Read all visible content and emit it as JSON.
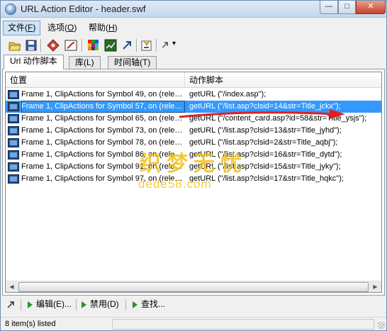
{
  "window": {
    "title": "URL Action Editor - header.swf",
    "controls": {
      "minimize": "—",
      "maximize": "□",
      "close": "✕"
    }
  },
  "menu": {
    "file": {
      "label": "文件(",
      "key": "F",
      "end": ")"
    },
    "options": {
      "label": "选项(",
      "key": "O",
      "end": ")"
    },
    "help": {
      "label": "帮助(",
      "key": "H",
      "end": ")"
    }
  },
  "toolbar": {
    "buttons": [
      "open-icon",
      "save-icon",
      "diamond-icon",
      "flash-icon",
      "color-grid-icon",
      "graph-icon",
      "arrow-icon",
      "wizard-icon",
      "cursor-dropdown-icon"
    ],
    "dropdown_glyph": "▾"
  },
  "tabs": [
    {
      "label": "Url 动作脚本",
      "active": true
    },
    {
      "label": "库(L)",
      "active": false
    },
    {
      "label": "时间轴(T)",
      "active": false
    }
  ],
  "list": {
    "columns": [
      "位置",
      "动作脚本"
    ],
    "rows": [
      {
        "location": "Frame 1, ClipActions for Symbol 49, on (releas...",
        "action": "getURL (\"/index.asp\");",
        "selected": false
      },
      {
        "location": "Frame 1, ClipActions for Symbol 57, on (releas...",
        "action": "getURL (\"/list.asp?clsid=14&str=Title_jckx\");",
        "selected": true
      },
      {
        "location": "Frame 1, ClipActions for Symbol 65, on (releas...",
        "action": "getURL (\"/content_card.asp?id=58&str=Title_ysjs\");",
        "selected": false
      },
      {
        "location": "Frame 1, ClipActions for Symbol 73, on (releas...",
        "action": "getURL (\"/list.asp?clsid=13&str=Title_jyhd\");",
        "selected": false
      },
      {
        "location": "Frame 1, ClipActions for Symbol 78, on (releas...",
        "action": "getURL (\"/list.asp?clsid=2&str=Title_aqbj\");",
        "selected": false
      },
      {
        "location": "Frame 1, ClipActions for Symbol 86, on (releas...",
        "action": "getURL (\"/list.asp?clsid=16&str=Title_dytd\");",
        "selected": false
      },
      {
        "location": "Frame 1, ClipActions for Symbol 91, on (releas...",
        "action": "getURL (\"/list.asp?clsid=15&str=Title_jyky\");",
        "selected": false
      },
      {
        "location": "Frame 1, ClipActions for Symbol 97, on (releas...",
        "action": "getURL (\"/list.asp?clsid=17&str=Title_hqkc\");",
        "selected": false
      }
    ],
    "scroll": {
      "left": "◀",
      "right": "▶"
    }
  },
  "watermark": {
    "top": "织梦无忧",
    "bottom": "dede58.com"
  },
  "actions": {
    "edit": "编辑(E)...",
    "disable": "禁用(D)",
    "find": "查找..."
  },
  "status": {
    "text": "8 item(s) listed"
  },
  "colors": {
    "selection": "#3399ff",
    "annotation_arrow": "#e02020",
    "watermark": "#f2c21b"
  }
}
